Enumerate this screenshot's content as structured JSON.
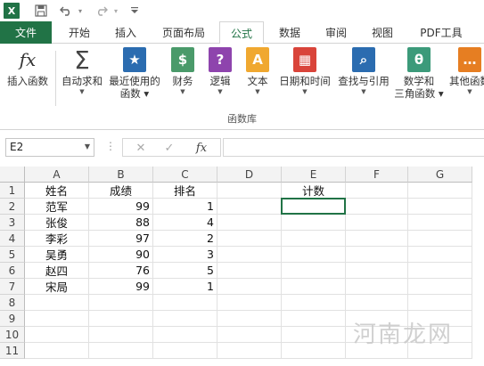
{
  "app": {
    "logo": "X",
    "accent": "#217346"
  },
  "tabs": [
    {
      "label": "文件",
      "active": false
    },
    {
      "label": "开始",
      "active": false
    },
    {
      "label": "插入",
      "active": false
    },
    {
      "label": "页面布局",
      "active": false
    },
    {
      "label": "公式",
      "active": true
    },
    {
      "label": "数据",
      "active": false
    },
    {
      "label": "审阅",
      "active": false
    },
    {
      "label": "视图",
      "active": false
    },
    {
      "label": "PDF工具",
      "active": false
    }
  ],
  "ribbon": {
    "group_label": "函数库",
    "buttons": [
      {
        "label": "插入函数",
        "icon": "fx-icon",
        "glyph": "fx",
        "color": "#ffffff",
        "textcolor": "#333333",
        "dd": false
      },
      {
        "label": "自动求和",
        "icon": "sigma-icon",
        "glyph": "Σ",
        "color": "#ffffff",
        "textcolor": "#444444",
        "dd": true
      },
      {
        "label": "最近使用的\n函数",
        "icon": "star-icon",
        "glyph": "★",
        "color": "#2b6cb0",
        "textcolor": "#ffffff",
        "dd": true
      },
      {
        "label": "财务",
        "icon": "coins-icon",
        "glyph": "$",
        "color": "#4a9a6a",
        "textcolor": "#ffffff",
        "dd": true
      },
      {
        "label": "逻辑",
        "icon": "question-icon",
        "glyph": "?",
        "color": "#8e44ad",
        "textcolor": "#ffffff",
        "dd": true
      },
      {
        "label": "文本",
        "icon": "text-a-icon",
        "glyph": "A",
        "color": "#f0a830",
        "textcolor": "#ffffff",
        "dd": true
      },
      {
        "label": "日期和时间",
        "icon": "calendar-icon",
        "glyph": "▦",
        "color": "#d9443a",
        "textcolor": "#ffffff",
        "dd": true
      },
      {
        "label": "查找与引用",
        "icon": "magnifier-icon",
        "glyph": "⌕",
        "color": "#2b6cb0",
        "textcolor": "#ffffff",
        "dd": true
      },
      {
        "label": "数学和\n三角函数",
        "icon": "theta-icon",
        "glyph": "θ",
        "color": "#3c9a7a",
        "textcolor": "#ffffff",
        "dd": true
      },
      {
        "label": "其他函数",
        "icon": "more-functions-icon",
        "glyph": "…",
        "color": "#e67e22",
        "textcolor": "#ffffff",
        "dd": true
      }
    ]
  },
  "formula_bar": {
    "name_box": "E2",
    "fx": "fx",
    "value": ""
  },
  "sheet": {
    "columns": [
      "A",
      "B",
      "C",
      "D",
      "E",
      "F",
      "G"
    ],
    "rows": [
      "1",
      "2",
      "3",
      "4",
      "5",
      "6",
      "7",
      "8",
      "9",
      "10",
      "11"
    ],
    "header_row": {
      "A": "姓名",
      "B": "成绩",
      "C": "排名",
      "E": "计数"
    },
    "data": [
      {
        "name": "范军",
        "score": "99",
        "rank": "1"
      },
      {
        "name": "张俊",
        "score": "88",
        "rank": "4"
      },
      {
        "name": "李彩",
        "score": "97",
        "rank": "2"
      },
      {
        "name": "吴勇",
        "score": "90",
        "rank": "3"
      },
      {
        "name": "赵四",
        "score": "76",
        "rank": "5"
      },
      {
        "name": "宋局",
        "score": "99",
        "rank": "1"
      }
    ]
  },
  "watermark": "河南龙网"
}
